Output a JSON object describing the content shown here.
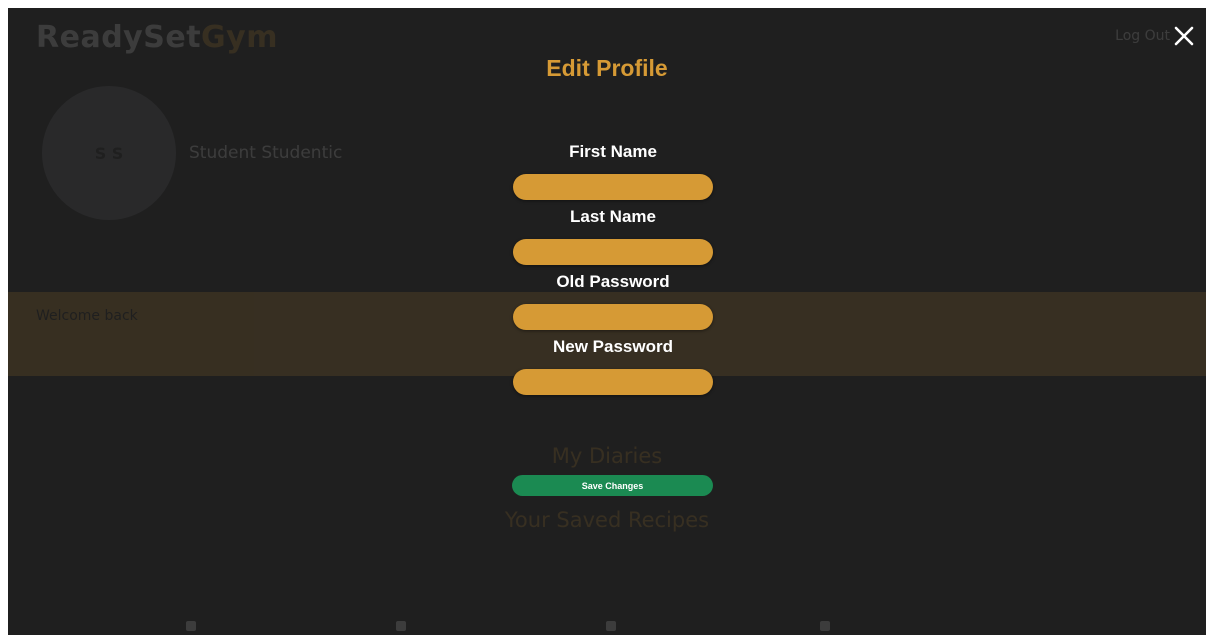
{
  "background": {
    "logo_ready": "Ready",
    "logo_set": "Set",
    "logo_gym": "Gym",
    "avatar_initials": "S S",
    "username": "Student Studentic",
    "logout_label": "Log Out",
    "banner_text": "Welcome back",
    "section_diaries": "My Diaries",
    "section_recipes": "Your Saved Recipes"
  },
  "modal": {
    "title": "Edit Profile",
    "close_icon": "close-icon",
    "fields": [
      {
        "label": "First Name",
        "value": ""
      },
      {
        "label": "Last Name",
        "value": ""
      },
      {
        "label": "Old Password",
        "value": ""
      },
      {
        "label": "New Password",
        "value": ""
      }
    ],
    "save_label": "Save Changes"
  },
  "colors": {
    "background": "#1f1f1f",
    "accent": "#d69a35",
    "save_button": "#1b8a52",
    "text": "#ffffff"
  }
}
